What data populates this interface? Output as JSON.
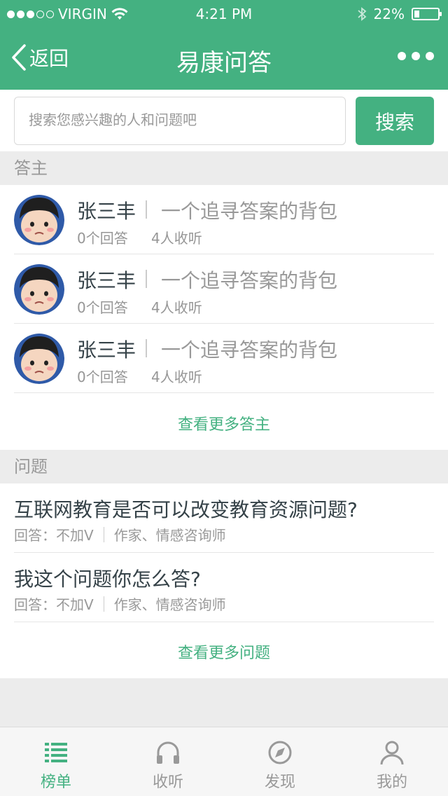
{
  "status": {
    "carrier": "VIRGIN",
    "time": "4:21 PM",
    "battery": "22%",
    "battery_level": 0.22
  },
  "nav": {
    "back_label": "返回",
    "title": "易康问答"
  },
  "search": {
    "placeholder": "搜索您感兴趣的人和问题吧",
    "button_label": "搜索"
  },
  "answerers": {
    "section_title": "答主",
    "items": [
      {
        "name": "张三丰",
        "motto": "一个追寻答案的背包",
        "answers": "0个回答",
        "listeners": "4人收听"
      },
      {
        "name": "张三丰",
        "motto": "一个追寻答案的背包",
        "answers": "0个回答",
        "listeners": "4人收听"
      },
      {
        "name": "张三丰",
        "motto": "一个追寻答案的背包",
        "answers": "0个回答",
        "listeners": "4人收听"
      }
    ],
    "more_label": "查看更多答主"
  },
  "questions": {
    "section_title": "问题",
    "items": [
      {
        "title": "互联网教育是否可以改变教育资源问题?",
        "answerer": "回答：不加V",
        "tag": "作家、情感咨询师"
      },
      {
        "title": "我这个问题你怎么答?",
        "answerer": "回答：不加V",
        "tag": "作家、情感咨询师"
      }
    ],
    "more_label": "查看更多问题"
  },
  "tabs": [
    {
      "label": "榜单",
      "icon": "list-icon",
      "active": true
    },
    {
      "label": "收听",
      "icon": "headphones-icon",
      "active": false
    },
    {
      "label": "发现",
      "icon": "compass-icon",
      "active": false
    },
    {
      "label": "我的",
      "icon": "user-icon",
      "active": false
    }
  ],
  "colors": {
    "brand": "#44b181",
    "text": "#354248",
    "muted": "#999999",
    "meta": "#969696"
  }
}
